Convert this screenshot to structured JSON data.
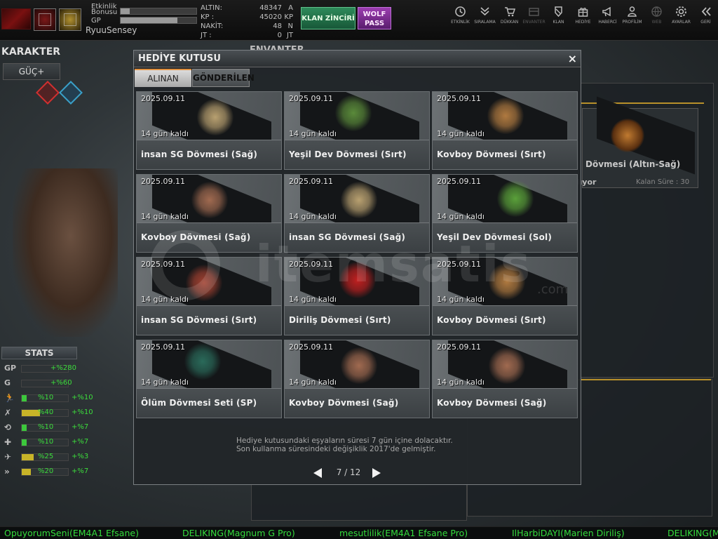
{
  "topbar": {
    "event_bonus_label": "Etkinlik\nBonusu",
    "event_bonus_line1": "Etkinlik",
    "event_bonus_line2": "Bonusu",
    "gp_label": "GP",
    "event_bonus_fill": 0.12,
    "gp_fill": 0.75,
    "username": "RyuuSensey",
    "currency": [
      {
        "name": "ALTIN:",
        "value": "48347",
        "unit": "A"
      },
      {
        "name": "KP   :",
        "value": "45020",
        "unit": "KP"
      },
      {
        "name": "NAKİT:",
        "value": "48",
        "unit": "N"
      },
      {
        "name": "JT   :",
        "value": "0",
        "unit": "JT"
      }
    ],
    "klan_button": "KLAN ZİNCİRİ",
    "wolf_button_line1": "WOLF",
    "wolf_button_line2": "PASS",
    "nav": [
      {
        "label": "ETKİNLİK",
        "icon": "clock-icon",
        "dim": false
      },
      {
        "label": "SIRALAMA",
        "icon": "rank-icon",
        "dim": false
      },
      {
        "label": "DÜKKAN",
        "icon": "cart-icon",
        "dim": false
      },
      {
        "label": "ENVANTER",
        "icon": "inventory-icon",
        "dim": true
      },
      {
        "label": "KLAN",
        "icon": "clan-icon",
        "dim": false
      },
      {
        "label": "HEDİYE",
        "icon": "gift-icon",
        "dim": false
      },
      {
        "label": "HABERCİ",
        "icon": "megaphone-icon",
        "dim": false
      },
      {
        "label": "PROFİLİM",
        "icon": "profile-icon",
        "dim": false
      },
      {
        "label": "WEB",
        "icon": "globe-icon",
        "dim": true
      },
      {
        "label": "AYARLAR",
        "icon": "gear-icon",
        "dim": false
      },
      {
        "label": "GERİ",
        "icon": "back-icon",
        "dim": false
      }
    ]
  },
  "left": {
    "title": "KARAKTER",
    "power_button": "GÜÇ+",
    "stats_title": "STATS",
    "stats": [
      {
        "icon": "GP",
        "v1": "+%280",
        "v2": "",
        "fill": 0.0,
        "color": "#3a8a3a",
        "wide": true
      },
      {
        "icon": "G",
        "v1": "+%60",
        "v2": "",
        "fill": 0.0,
        "color": "#3a8a3a",
        "wide": true
      },
      {
        "icon": "run-icon",
        "v1": "%10",
        "v2": "+%10",
        "fill": 0.1,
        "color": "#3cc83c"
      },
      {
        "icon": "jump-icon",
        "v1": "%40",
        "v2": "+%10",
        "fill": 0.4,
        "color": "#c8b428"
      },
      {
        "icon": "reload-icon",
        "v1": "%10",
        "v2": "+%7",
        "fill": 0.1,
        "color": "#3cc83c"
      },
      {
        "icon": "health-icon",
        "v1": "%10",
        "v2": "+%7",
        "fill": 0.1,
        "color": "#3cc83c"
      },
      {
        "icon": "speed-icon",
        "v1": "%25",
        "v2": "+%3",
        "fill": 0.25,
        "color": "#c8b428"
      },
      {
        "icon": "dash-icon",
        "v1": "%20",
        "v2": "+%7",
        "fill": 0.2,
        "color": "#c8b428"
      }
    ]
  },
  "inventory_bg": {
    "title": "ENVANTER",
    "card_label": "Dövmesi (Altın-Sağ)",
    "card_status": "ılıyor",
    "card_remaining": "Kalan Süre : 30"
  },
  "dialog": {
    "title": "HEDİYE KUTUSU",
    "close": "×",
    "tabs": {
      "received": "ALINAN",
      "sent": "GÖNDERİLEN"
    },
    "items": [
      {
        "date": "2025.09.11",
        "days": "14 gün kaldı",
        "name": "insan SG Dövmesi (Sağ)",
        "icon": "sg-emblem-icon",
        "tint": "#b8a070"
      },
      {
        "date": "2025.09.11",
        "days": "14 gün kaldı",
        "name": "Yeşil Dev Dövmesi (Sırt)",
        "icon": "green-giant-icon",
        "tint": "#5a8a3a"
      },
      {
        "date": "2025.09.11",
        "days": "14 gün kaldı",
        "name": "Kovboy Dövmesi (Sırt)",
        "icon": "cowboy-skull-icon",
        "tint": "#b07a40"
      },
      {
        "date": "2025.09.11",
        "days": "14 gün kaldı",
        "name": "Kovboy Dövmesi (Sağ)",
        "icon": "cowboy-skull-icon",
        "tint": "#a06a50"
      },
      {
        "date": "2025.09.11",
        "days": "14 gün kaldı",
        "name": "insan SG Dövmesi (Sağ)",
        "icon": "sg-emblem-icon",
        "tint": "#b8a070"
      },
      {
        "date": "2025.09.11",
        "days": "14 gün kaldı",
        "name": "Yeşil Dev Dövmesi (Sol)",
        "icon": "green-giant-icon",
        "tint": "#5aa03a"
      },
      {
        "date": "2025.09.11",
        "days": "14 gün kaldı",
        "name": "insan SG Dövmesi (Sırt)",
        "icon": "winged-skull-icon",
        "tint": "#a04030"
      },
      {
        "date": "2025.09.11",
        "days": "14 gün kaldı",
        "name": "Diriliş Dövmesi (Sırt)",
        "icon": "wolf-emblem-icon",
        "tint": "#c02020"
      },
      {
        "date": "2025.09.11",
        "days": "14 gün kaldı",
        "name": "Kovboy Dövmesi (Sırt)",
        "icon": "cowboy-skull-icon",
        "tint": "#b07a40"
      },
      {
        "date": "2025.09.11",
        "days": "14 gün kaldı",
        "name": "Ölüm Dövmesi Seti (SP)",
        "icon": "reaper-icon",
        "tint": "#2a6a5a"
      },
      {
        "date": "2025.09.11",
        "days": "14 gün kaldı",
        "name": "Kovboy Dövmesi (Sağ)",
        "icon": "cowboy-skull-icon",
        "tint": "#a06a50"
      },
      {
        "date": "2025.09.11",
        "days": "14 gün kaldı",
        "name": "Kovboy Dövmesi (Sağ)",
        "icon": "cowboy-skull-icon",
        "tint": "#a06a50"
      }
    ],
    "info_line1": "Hediye kutusundaki eşyaların süresi 7 gün içine dolacaktır.",
    "info_line2": "Son kullanma süresindeki değişiklik 2017'de gelmiştir.",
    "page": "7 / 12"
  },
  "watermark": {
    "word": "itemsatis",
    "suffix": ".com"
  },
  "ticker": [
    "OpuyorumSeni(EM4A1 Efsane)",
    "DELIKING(Magnum G Pro)",
    "mesutlilik(EM4A1 Efsane Pro)",
    "IlHarbiDAYI(Marien Diriliş)",
    "DELIKING(M"
  ],
  "colors": {
    "accent": "#e09040",
    "ticker_green": "#34dc3c",
    "gold": "#b8902a"
  }
}
